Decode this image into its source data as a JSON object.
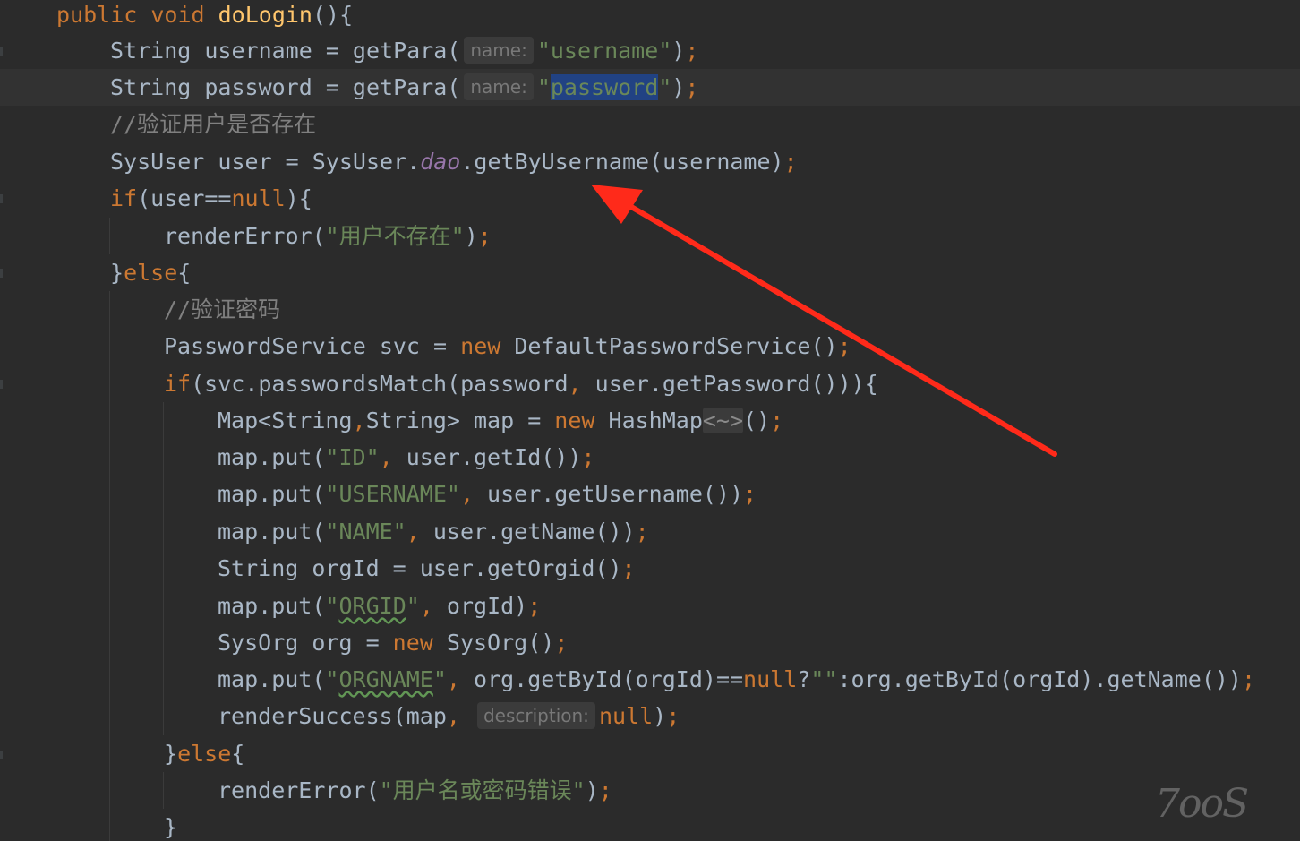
{
  "editor": {
    "lines": [
      {
        "tokens": [
          [
            "kw",
            "public "
          ],
          [
            "kw",
            "void "
          ],
          [
            "fn",
            "doLogin"
          ],
          [
            "p",
            "(){"
          ]
        ]
      },
      {
        "tokens": [
          [
            "p",
            "String username = getPara("
          ],
          [
            "hint",
            "name:"
          ],
          [
            "str",
            "\"username\""
          ],
          [
            "p",
            ")"
          ],
          [
            "punc",
            ";"
          ]
        ]
      },
      {
        "tokens": [
          [
            "p",
            "String password = getPara("
          ],
          [
            "hint",
            "name:"
          ],
          [
            "str",
            "\""
          ],
          [
            "sel",
            "password"
          ],
          [
            "str",
            "\""
          ],
          [
            "p",
            ")"
          ],
          [
            "punc",
            ";"
          ]
        ]
      },
      {
        "tokens": [
          [
            "cmt",
            "//验证用户是否存在"
          ]
        ]
      },
      {
        "tokens": [
          [
            "p",
            "SysUser user = SysUser."
          ],
          [
            "stat",
            "dao"
          ],
          [
            "p",
            ".getByUsername(username)"
          ],
          [
            "punc",
            ";"
          ]
        ]
      },
      {
        "tokens": [
          [
            "kw",
            "if"
          ],
          [
            "p",
            "(user=="
          ],
          [
            "kw",
            "null"
          ],
          [
            "p",
            "){"
          ]
        ]
      },
      {
        "tokens": [
          [
            "p",
            "renderError("
          ],
          [
            "str",
            "\"用户不存在\""
          ],
          [
            "p",
            ")"
          ],
          [
            "punc",
            ";"
          ]
        ]
      },
      {
        "tokens": [
          [
            "p",
            "}"
          ],
          [
            "kw",
            "else"
          ],
          [
            "p",
            "{"
          ]
        ]
      },
      {
        "tokens": [
          [
            "cmt",
            "//验证密码"
          ]
        ]
      },
      {
        "tokens": [
          [
            "p",
            "PasswordService svc = "
          ],
          [
            "kw",
            "new "
          ],
          [
            "p",
            "DefaultPasswordService()"
          ],
          [
            "punc",
            ";"
          ]
        ]
      },
      {
        "tokens": [
          [
            "kw",
            "if"
          ],
          [
            "p",
            "(svc.passwordsMatch(password"
          ],
          [
            "punc",
            ", "
          ],
          [
            "p",
            "user.getPassword())){"
          ]
        ]
      },
      {
        "tokens": [
          [
            "p",
            "Map<String"
          ],
          [
            "punc",
            ","
          ],
          [
            "p",
            "String> map = "
          ],
          [
            "kw",
            "new "
          ],
          [
            "p",
            "HashMap"
          ],
          [
            "dim",
            "<~>"
          ],
          [
            "p",
            "()"
          ],
          [
            "punc",
            ";"
          ]
        ]
      },
      {
        "tokens": [
          [
            "p",
            "map.put("
          ],
          [
            "str",
            "\"ID\""
          ],
          [
            "punc",
            ", "
          ],
          [
            "p",
            "user.getId())"
          ],
          [
            "punc",
            ";"
          ]
        ]
      },
      {
        "tokens": [
          [
            "p",
            "map.put("
          ],
          [
            "str",
            "\"USERNAME\""
          ],
          [
            "punc",
            ", "
          ],
          [
            "p",
            "user.getUsername())"
          ],
          [
            "punc",
            ";"
          ]
        ]
      },
      {
        "tokens": [
          [
            "p",
            "map.put("
          ],
          [
            "str",
            "\"NAME\""
          ],
          [
            "punc",
            ", "
          ],
          [
            "p",
            "user.getName())"
          ],
          [
            "punc",
            ";"
          ]
        ]
      },
      {
        "tokens": [
          [
            "p",
            "String orgId = user.getOrgid()"
          ],
          [
            "punc",
            ";"
          ]
        ]
      },
      {
        "tokens": [
          [
            "p",
            "map.put("
          ],
          [
            "str",
            "\""
          ],
          [
            "squig",
            "ORGID"
          ],
          [
            "str",
            "\""
          ],
          [
            "punc",
            ", "
          ],
          [
            "p",
            "orgId)"
          ],
          [
            "punc",
            ";"
          ]
        ]
      },
      {
        "tokens": [
          [
            "p",
            "SysOrg org = "
          ],
          [
            "kw",
            "new "
          ],
          [
            "p",
            "SysOrg()"
          ],
          [
            "punc",
            ";"
          ]
        ]
      },
      {
        "tokens": [
          [
            "p",
            "map.put("
          ],
          [
            "str",
            "\""
          ],
          [
            "squig",
            "ORGNAME"
          ],
          [
            "str",
            "\""
          ],
          [
            "punc",
            ", "
          ],
          [
            "p",
            "org.getById(orgId)=="
          ],
          [
            "kw",
            "null"
          ],
          [
            "p",
            "?"
          ],
          [
            "str",
            "\"\""
          ],
          [
            "p",
            ":org.getById(orgId).getName())"
          ],
          [
            "punc",
            ";"
          ]
        ]
      },
      {
        "tokens": [
          [
            "p",
            "renderSuccess(map"
          ],
          [
            "punc",
            ", "
          ],
          [
            "hint",
            "description:"
          ],
          [
            "kw",
            "null"
          ],
          [
            "p",
            ")"
          ],
          [
            "punc",
            ";"
          ]
        ]
      },
      {
        "tokens": [
          [
            "p",
            "}"
          ],
          [
            "kw",
            "else"
          ],
          [
            "p",
            "{"
          ]
        ]
      },
      {
        "tokens": [
          [
            "p",
            "renderError("
          ],
          [
            "str",
            "\"用户名或密码错误\""
          ],
          [
            "p",
            ")"
          ],
          [
            "punc",
            ";"
          ]
        ]
      },
      {
        "tokens": [
          [
            "p",
            "}"
          ]
        ]
      }
    ]
  },
  "annotation": {
    "arrow_color": "#ff2a1a"
  },
  "watermark": {
    "text": "7ooS"
  },
  "icons": {
    "gutter_hint": "lightbulb-icon"
  }
}
